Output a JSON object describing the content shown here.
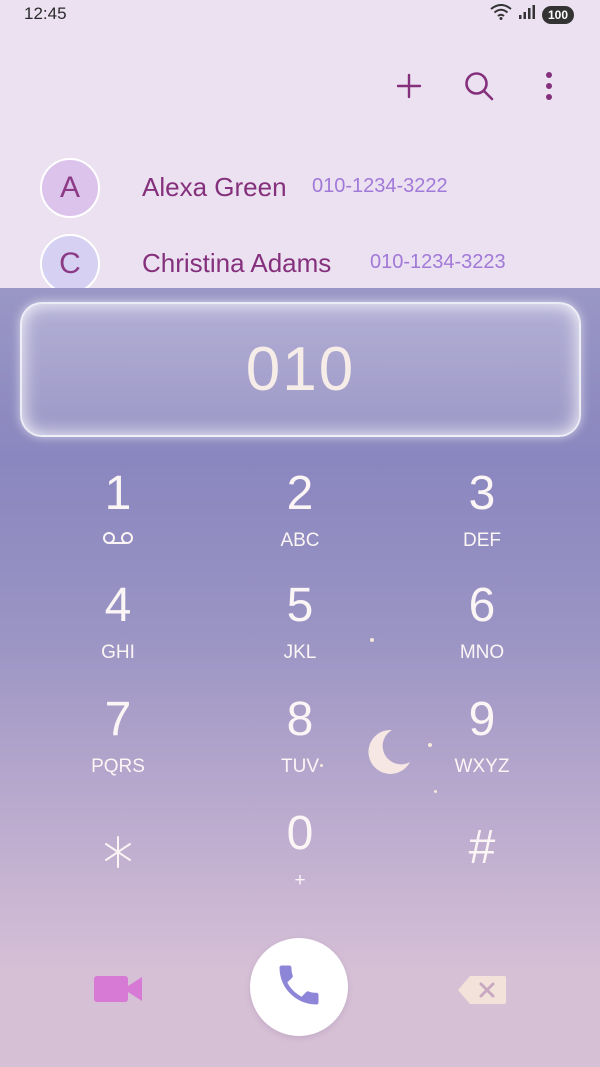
{
  "status": {
    "time": "12:45",
    "battery": "100",
    "icons": [
      "wifi-icon",
      "signal-icon",
      "battery-icon"
    ]
  },
  "toolbar": {
    "icons": [
      "add-icon",
      "search-icon",
      "more-vertical-icon"
    ]
  },
  "contacts": [
    {
      "initial": "A",
      "name": "Alexa Green",
      "number": "010-1234-3222",
      "avatar_color": "#dcc3ec"
    },
    {
      "initial": "C",
      "name": "Christina Adams",
      "number": "010-1234-3223",
      "avatar_color": "#d6d0f2"
    }
  ],
  "dialer": {
    "input_value": "010",
    "keys": [
      {
        "num": "1",
        "sub": "",
        "icon": "voicemail-icon"
      },
      {
        "num": "2",
        "sub": "ABC"
      },
      {
        "num": "3",
        "sub": "DEF"
      },
      {
        "num": "4",
        "sub": "GHI"
      },
      {
        "num": "5",
        "sub": "JKL"
      },
      {
        "num": "6",
        "sub": "MNO"
      },
      {
        "num": "7",
        "sub": "PQRS"
      },
      {
        "num": "8",
        "sub": "TUV"
      },
      {
        "num": "9",
        "sub": "WXYZ"
      },
      {
        "num": "*",
        "sub": ""
      },
      {
        "num": "0",
        "sub": "+"
      },
      {
        "num": "#",
        "sub": ""
      }
    ]
  },
  "actions": {
    "icons": [
      "video-call-icon",
      "phone-icon",
      "backspace-icon"
    ]
  },
  "colors": {
    "accent": "#85307c",
    "number": "#a179d8",
    "video": "#d77ad6",
    "phone": "#8d86d8"
  }
}
